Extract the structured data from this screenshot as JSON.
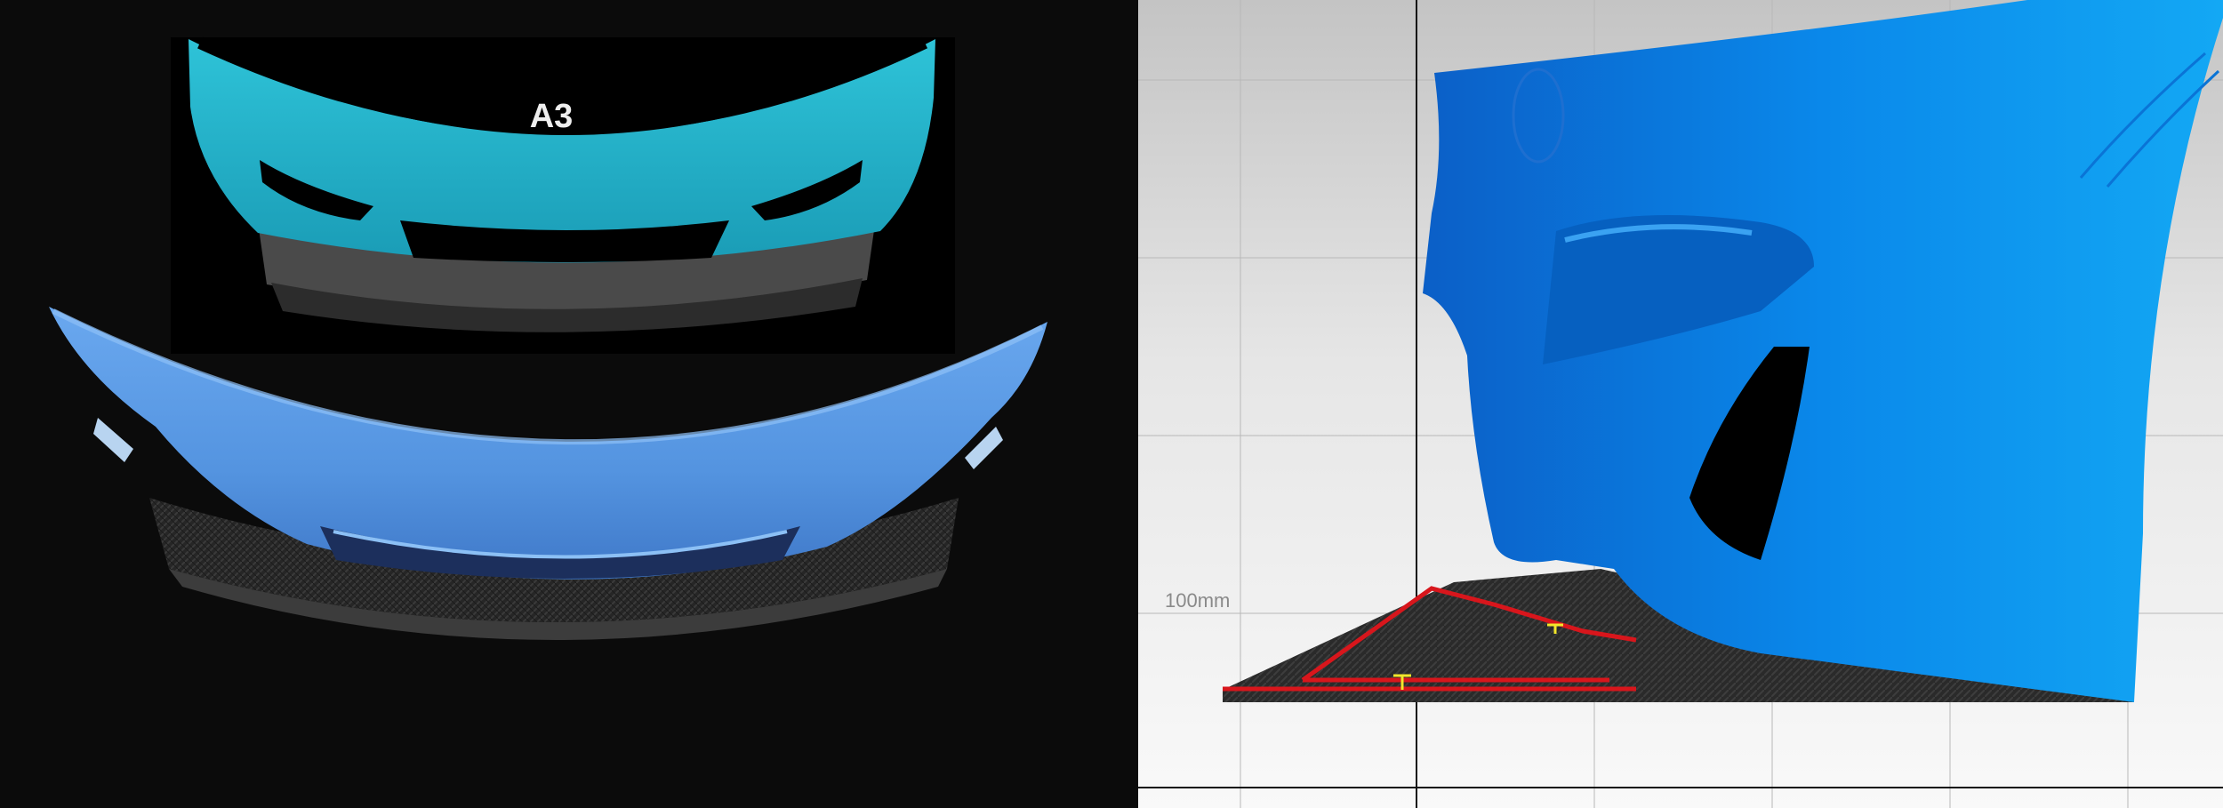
{
  "left_view": {
    "inset_label": "A3",
    "colors": {
      "background": "#0b0b0b",
      "inset_background": "#000000",
      "inset_bumper": "#22b4cc",
      "bumper": "#5b9ee8",
      "carbon_splitter": "#2d2d2d"
    }
  },
  "right_view": {
    "scale_label": "100mm",
    "colors": {
      "bumper": "#0a82e6",
      "outline": "#d8161c",
      "marker": "#f2e62a",
      "grid_line": "#b7b7b7",
      "axis_line": "#111111"
    }
  }
}
